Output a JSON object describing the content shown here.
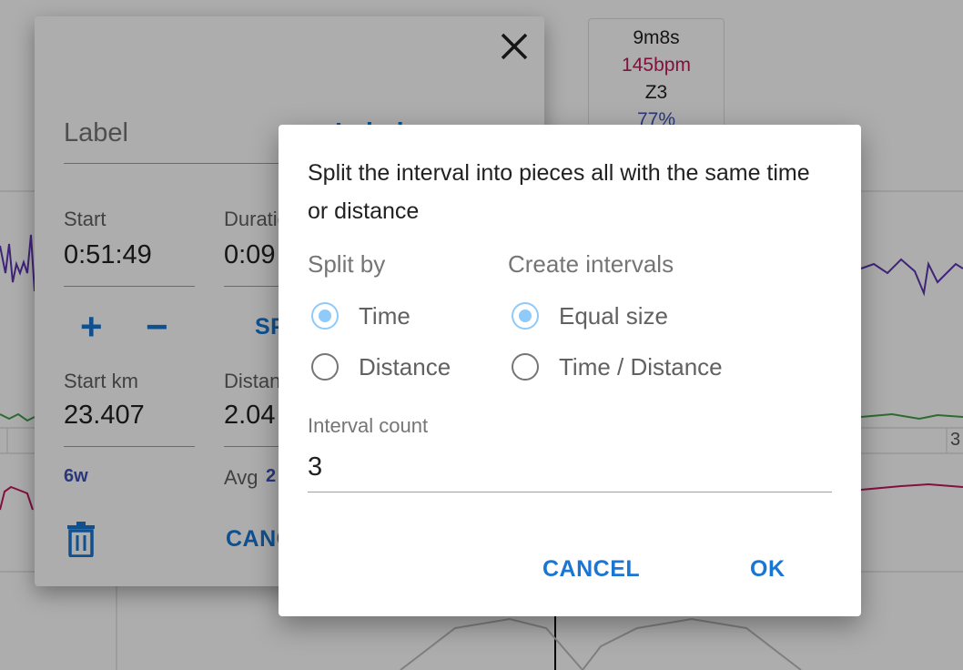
{
  "tooltip": {
    "duration": "9m8s",
    "heart_rate": "145bpm",
    "zone": "Z3",
    "percent": "77%"
  },
  "axis_tick": "3",
  "editor": {
    "label_placeholder": "Label",
    "label_text": "Label",
    "start_caption": "Start",
    "start_value": "0:51:49",
    "duration_caption": "Duration",
    "duration_value": "0:09",
    "split_link": "SPLIT",
    "start_km_caption": "Start km",
    "start_km_value": "23.407",
    "distance_caption": "Distance",
    "distance_value": "2.04",
    "watts_small": "6w",
    "avg_caption": "Avg",
    "avg_value": "2",
    "cancel_label": "CANCEL",
    "plus": "+",
    "minus": "−"
  },
  "split_dialog": {
    "message": "Split the interval into pieces all with the same time or distance",
    "split_by": {
      "title": "Split by",
      "options": [
        {
          "label": "Time",
          "checked": true
        },
        {
          "label": "Distance",
          "checked": false
        }
      ]
    },
    "create_intervals": {
      "title": "Create intervals",
      "options": [
        {
          "label": "Equal size",
          "checked": true
        },
        {
          "label": "Time / Distance",
          "checked": false
        }
      ]
    },
    "interval_count": {
      "caption": "Interval count",
      "value": "3"
    },
    "cancel_label": "CANCEL",
    "ok_label": "OK"
  },
  "colors": {
    "accent": "#1976d2",
    "radio_checked": "#90caf9",
    "heart_rate": "#c2185b",
    "power": "#5e35b1"
  }
}
